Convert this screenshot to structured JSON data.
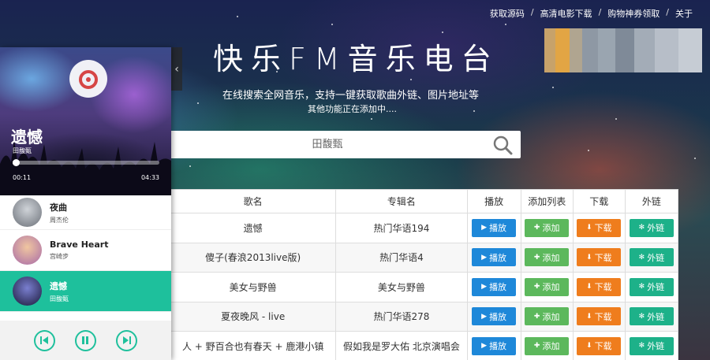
{
  "top_links": [
    "获取源码",
    "高清电影下载",
    "购物神券领取",
    "关于"
  ],
  "site": {
    "title": "快乐FM音乐电台",
    "subtitle": "在线搜索全网音乐，支持一键获取歌曲外链、图片地址等",
    "subtitle2": "其他功能正在添加中...."
  },
  "search": {
    "placeholder": "田馥甄",
    "icon": "search-icon"
  },
  "table": {
    "headers": [
      "歌名",
      "专辑名",
      "播放",
      "添加列表",
      "下载",
      "外链"
    ],
    "rows": [
      {
        "song": "遗憾",
        "album": "热门华语194"
      },
      {
        "song": "傻子(春浪2013live版)",
        "album": "热门华语4"
      },
      {
        "song": "美女与野兽",
        "album": "美女与野兽"
      },
      {
        "song": "夏夜晚风 - live",
        "album": "热门华语278"
      },
      {
        "song": "人 + 野百合也有春天 + 鹿港小镇",
        "album": "假如我是罗大佑 北京演唱会"
      }
    ],
    "buttons": {
      "play": "播放",
      "add": "添加",
      "download": "下载",
      "external": "外链"
    },
    "colors": {
      "play": "#1e88d9",
      "add": "#5cb85c",
      "download": "#ef7d1d",
      "external": "#1db189"
    }
  },
  "player": {
    "now_playing": {
      "title": "遗憾",
      "artist": "田馥甄"
    },
    "progress": 0.02,
    "time_current": "00:11",
    "time_total": "04:33",
    "playlist": [
      {
        "name": "夜曲",
        "artist": "周杰伦"
      },
      {
        "name": "Brave Heart",
        "artist": "宫崎步"
      },
      {
        "name": "遗憾",
        "artist": "田馥甄"
      }
    ],
    "accent": "#1ec09c"
  }
}
